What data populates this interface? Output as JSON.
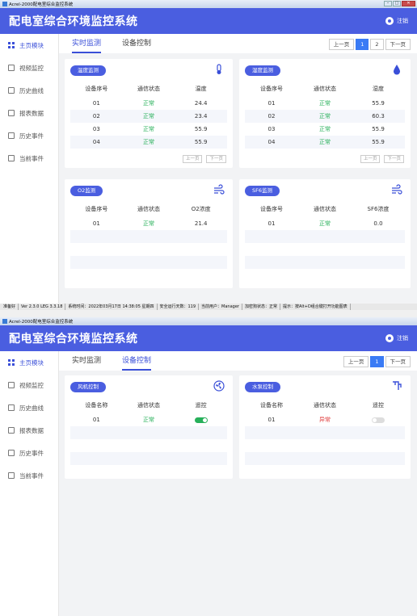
{
  "window_title": "Acrel-2000配电室综合监控系统",
  "app_title": "配电室综合环境监控系统",
  "logout": "注销",
  "sidebar": [
    "主页模块",
    "视频监控",
    "历史曲线",
    "报表数据",
    "历史事件",
    "当前事件"
  ],
  "tabs": [
    "实时监测",
    "设备控制"
  ],
  "pager": {
    "prev": "上一页",
    "p1": "1",
    "p2": "2",
    "next": "下一页"
  },
  "mini_pager": {
    "prev": "上一页",
    "next": "下一页"
  },
  "monitor": {
    "temp": {
      "title": "温度监测",
      "headers": [
        "设备序号",
        "通信状态",
        "温度"
      ],
      "rows": [
        [
          "01",
          "正常",
          "24.4"
        ],
        [
          "02",
          "正常",
          "23.4"
        ],
        [
          "03",
          "正常",
          "55.9"
        ],
        [
          "04",
          "正常",
          "55.9"
        ]
      ]
    },
    "humid": {
      "title": "湿度监测",
      "headers": [
        "设备序号",
        "通信状态",
        "湿度"
      ],
      "rows": [
        [
          "01",
          "正常",
          "55.9"
        ],
        [
          "02",
          "正常",
          "60.3"
        ],
        [
          "03",
          "正常",
          "55.9"
        ],
        [
          "04",
          "正常",
          "55.9"
        ]
      ]
    },
    "o2": {
      "title": "O2监测",
      "headers": [
        "设备序号",
        "通信状态",
        "O2浓度"
      ],
      "rows": [
        [
          "01",
          "正常",
          "21.4"
        ]
      ]
    },
    "sf6": {
      "title": "SF6监测",
      "headers": [
        "设备序号",
        "通信状态",
        "SF6浓度"
      ],
      "rows": [
        [
          "01",
          "正常",
          "0.0"
        ]
      ]
    }
  },
  "control": {
    "fan": {
      "title": "风机控制",
      "headers": [
        "设备名称",
        "通信状态",
        "遥控"
      ],
      "rows": [
        [
          "01",
          "正常"
        ]
      ],
      "toggle": "on"
    },
    "pump": {
      "title": "水泵控制",
      "headers": [
        "设备名称",
        "通信状态",
        "遥控"
      ],
      "rows": [
        [
          "01",
          "异常"
        ]
      ],
      "toggle": "off"
    }
  },
  "statusbar": [
    "准备好",
    "Ver 2.3.0 LEG 3.3.18",
    "系统时间：2022年03月17日 14:38:05 星期四",
    "安全运行天数：119",
    "当前用户：Manager",
    "加密狗状态：正常",
    "提示：按Alt+D组合键打开功能图表"
  ],
  "colors": {
    "header": "#4a5ee0",
    "accent": "#3a7bf5",
    "ok": "#27b05a",
    "error": "#e03c3c"
  }
}
